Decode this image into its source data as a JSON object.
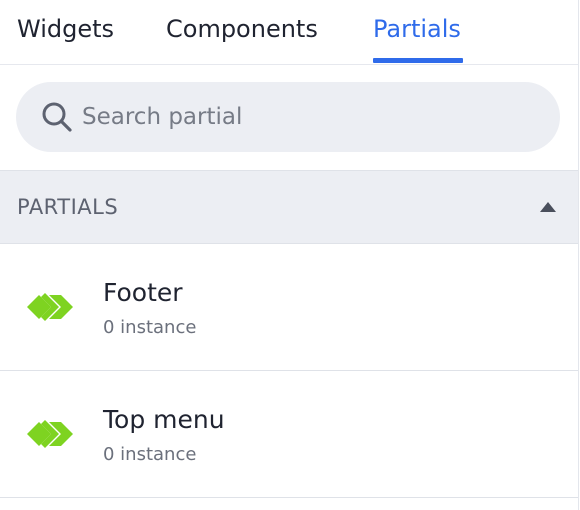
{
  "tabs": [
    {
      "label": "Widgets",
      "active": false
    },
    {
      "label": "Components",
      "active": false
    },
    {
      "label": "Partials",
      "active": true
    }
  ],
  "search": {
    "placeholder": "Search partial",
    "value": ""
  },
  "section": {
    "title": "PARTIALS",
    "collapse_icon": "triangle-up-icon"
  },
  "items": [
    {
      "name": "Footer",
      "meta": "0 instance",
      "icon": "partial-icon"
    },
    {
      "name": "Top menu",
      "meta": "0 instance",
      "icon": "partial-icon"
    }
  ],
  "colors": {
    "accent": "#2f6bea",
    "partial_icon": "#7ed321",
    "header_bg": "#eceef3",
    "search_bg": "#eceef3"
  }
}
